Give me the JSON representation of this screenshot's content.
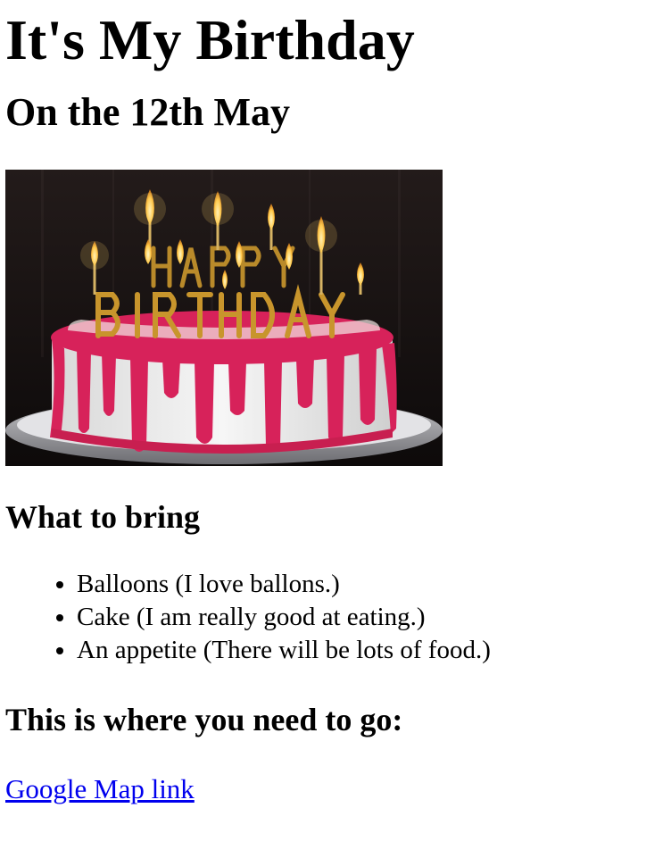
{
  "page": {
    "title": "It's My Birthday",
    "subtitle": "On the 12th May",
    "image": {
      "letters_line1": "HAPPY",
      "letters_line2": "BIRTHDAY"
    },
    "bring_heading": "What to bring",
    "bring_items": [
      "Balloons (I love ballons.)",
      "Cake (I am really good at eating.)",
      "An appetite (There will be lots of food.)"
    ],
    "location_heading": "This is where you need to go:",
    "map_link_label": "Google Map link"
  },
  "colors": {
    "link": "#0000ee",
    "icing": "#d7225a",
    "cake_white": "#ededed",
    "background_dark": "#1a1414",
    "candle_gold": "#b98a2a",
    "flame": "#ffd36b"
  }
}
